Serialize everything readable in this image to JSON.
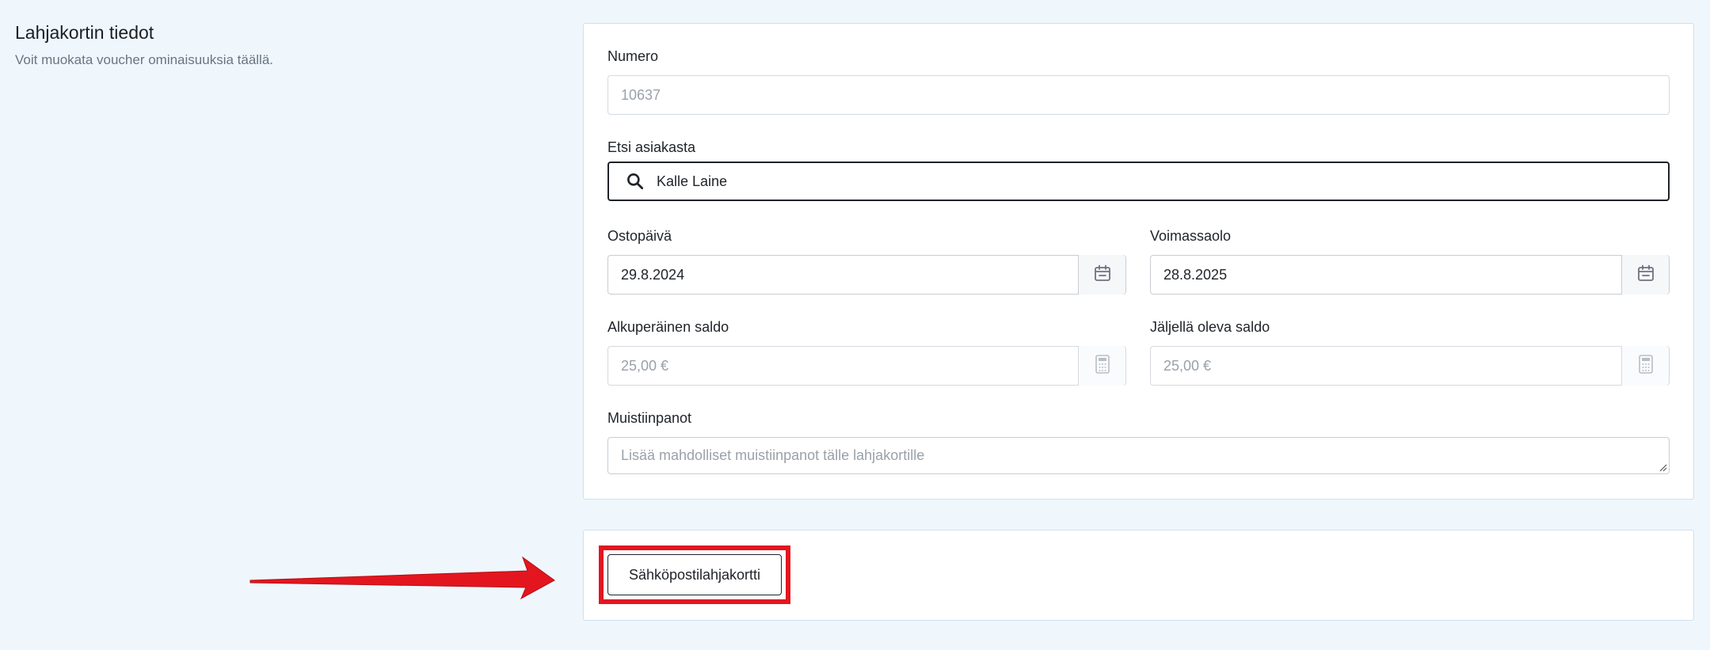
{
  "section": {
    "title": "Lahjakortin tiedot",
    "subtitle": "Voit muokata voucher ominaisuuksia täällä."
  },
  "form": {
    "number": {
      "label": "Numero",
      "value": "10637"
    },
    "customer": {
      "label": "Etsi asiakasta",
      "value": "Kalle Laine",
      "icon": "search-icon"
    },
    "purchase_date": {
      "label": "Ostopäivä",
      "value": "29.8.2024",
      "icon": "calendar-icon"
    },
    "valid_until": {
      "label": "Voimassaolo",
      "value": "28.8.2025",
      "icon": "calendar-icon"
    },
    "original_balance": {
      "label": "Alkuperäinen saldo",
      "value": "25,00 €",
      "icon": "calculator-icon"
    },
    "remaining_balance": {
      "label": "Jäljellä oleva saldo",
      "value": "25,00 €",
      "icon": "calculator-icon"
    },
    "notes": {
      "label": "Muistiinpanot",
      "placeholder": "Lisää mahdolliset muistiinpanot tälle lahjakortille"
    }
  },
  "actions": {
    "email_giftcard_label": "Sähköpostilahjakortti"
  },
  "colors": {
    "background": "#eff7fd",
    "highlight": "#e3161f",
    "arrow": "#e3161f"
  }
}
